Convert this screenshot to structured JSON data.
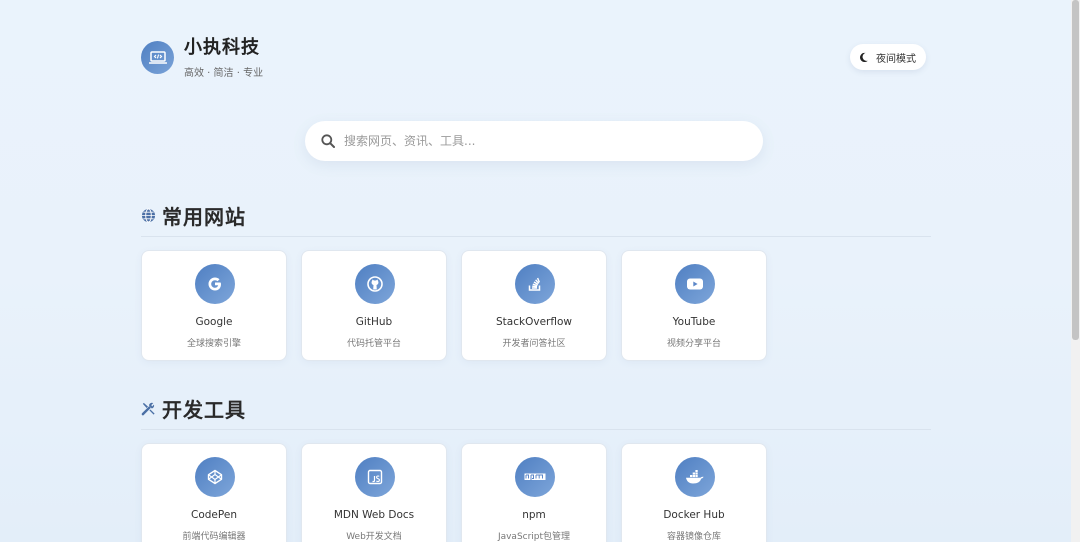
{
  "brand": {
    "title": "小执科技",
    "tagline": "高效 · 简洁 · 专业",
    "logo_icon": "code-laptop-icon"
  },
  "theme_toggle": {
    "label": "夜间模式",
    "icon": "moon-icon"
  },
  "search": {
    "placeholder": "搜索网页、资讯、工具...",
    "value": "",
    "icon": "search-icon"
  },
  "colors": {
    "accent": "#5b87c8",
    "background": "#eaf3fc",
    "card": "#ffffff"
  },
  "sections": [
    {
      "title": "常用网站",
      "icon": "globe-icon",
      "cards": [
        {
          "name": "Google",
          "desc": "全球搜索引擎",
          "icon": "google-icon"
        },
        {
          "name": "GitHub",
          "desc": "代码托管平台",
          "icon": "github-icon"
        },
        {
          "name": "StackOverflow",
          "desc": "开发者问答社区",
          "icon": "stackoverflow-icon"
        },
        {
          "name": "YouTube",
          "desc": "视频分享平台",
          "icon": "youtube-icon"
        }
      ]
    },
    {
      "title": "开发工具",
      "icon": "tools-icon",
      "cards": [
        {
          "name": "CodePen",
          "desc": "前端代码编辑器",
          "icon": "codepen-icon"
        },
        {
          "name": "MDN Web Docs",
          "desc": "Web开发文档",
          "icon": "js-doc-icon"
        },
        {
          "name": "npm",
          "desc": "JavaScript包管理",
          "icon": "npm-icon"
        },
        {
          "name": "Docker Hub",
          "desc": "容器镜像仓库",
          "icon": "docker-icon"
        }
      ]
    }
  ]
}
